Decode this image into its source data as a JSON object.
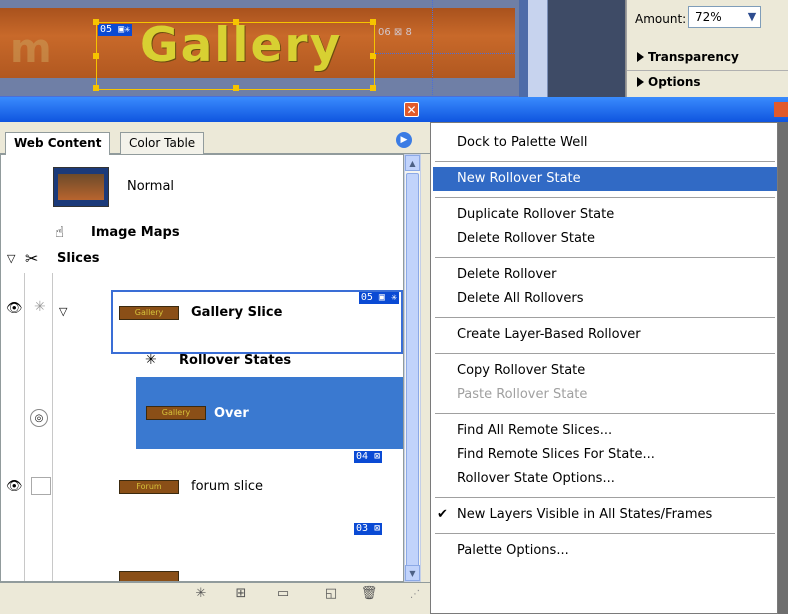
{
  "canvas": {
    "banner_word": "Gallery",
    "banner_left_letter": "m",
    "slice_tag_05": "05",
    "slice_tag_06": "06"
  },
  "properties": {
    "amount_label": "Amount:",
    "amount_value": "72%",
    "transparency_label": "Transparency",
    "options_label": "Options"
  },
  "palette": {
    "tabs": [
      "Web Content",
      "Color Table"
    ],
    "rows": {
      "normal": "Normal",
      "image_maps": "Image Maps",
      "slices": "Slices",
      "gallery_slice": "Gallery Slice",
      "rollover_states": "Rollover States",
      "over": "Over",
      "forum_slice": "forum slice"
    },
    "thumb_labels": {
      "gallery": "Gallery",
      "forum": "Forum"
    },
    "slice_tags": {
      "gallery": "05",
      "forum": "04",
      "third": "03"
    }
  },
  "menu": {
    "items": [
      {
        "label": "Dock to Palette Well",
        "state": "normal"
      },
      {
        "label": "New Rollover State",
        "state": "highlighted"
      },
      {
        "label": "Duplicate Rollover State",
        "state": "normal"
      },
      {
        "label": "Delete Rollover State",
        "state": "normal"
      },
      {
        "label": "Delete Rollover",
        "state": "normal"
      },
      {
        "label": "Delete All Rollovers",
        "state": "normal"
      },
      {
        "label": "Create Layer-Based Rollover",
        "state": "normal"
      },
      {
        "label": "Copy Rollover State",
        "state": "normal"
      },
      {
        "label": "Paste Rollover State",
        "state": "disabled"
      },
      {
        "label": "Find All Remote Slices...",
        "state": "normal"
      },
      {
        "label": "Find Remote Slices For State...",
        "state": "normal"
      },
      {
        "label": "Rollover State Options...",
        "state": "normal"
      },
      {
        "label": "New Layers Visible in All States/Frames",
        "state": "checked"
      },
      {
        "label": "Palette Options...",
        "state": "normal"
      }
    ]
  },
  "colors": {
    "titlebar": "#0f55df",
    "highlight": "#316ac5",
    "selected_row": "#3a79d0"
  }
}
